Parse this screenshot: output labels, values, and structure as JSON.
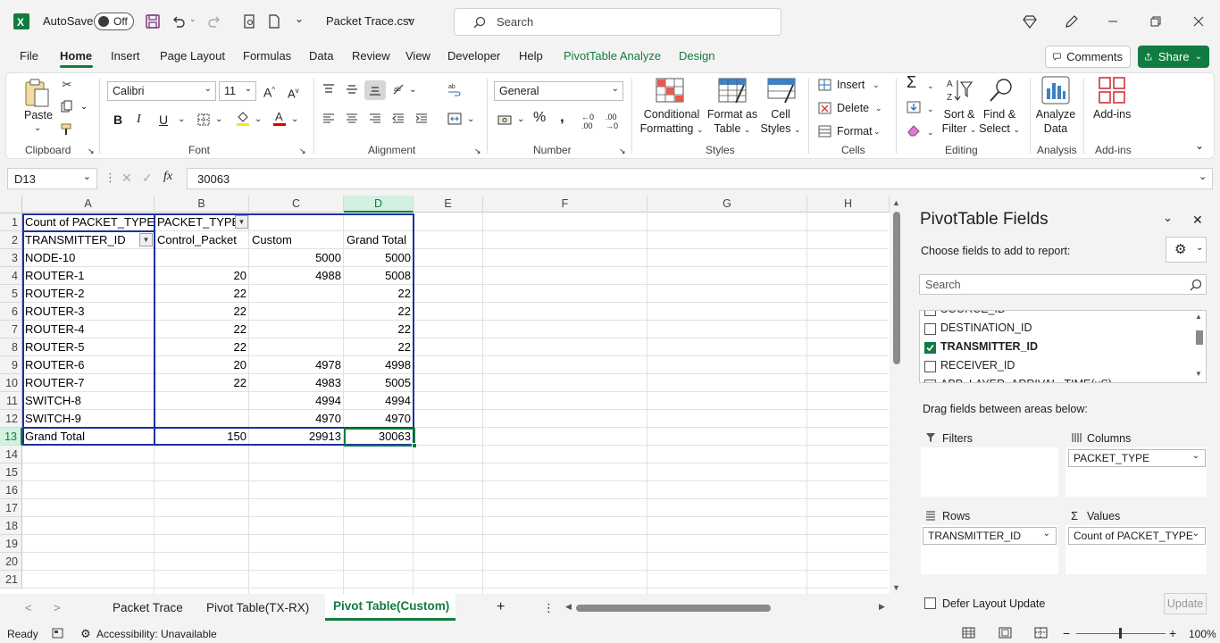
{
  "titlebar": {
    "autosave_label": "AutoSave",
    "autosave_state": "Off",
    "filename": "Packet Trace.csv",
    "search_placeholder": "Search"
  },
  "menu": {
    "tabs": [
      "File",
      "Home",
      "Insert",
      "Page Layout",
      "Formulas",
      "Data",
      "Review",
      "View",
      "Developer",
      "Help",
      "PivotTable Analyze",
      "Design"
    ],
    "active": "Home",
    "comments_label": "Comments",
    "share_label": "Share"
  },
  "ribbon": {
    "clipboard": {
      "paste": "Paste",
      "label": "Clipboard"
    },
    "font": {
      "name": "Calibri",
      "size": "11",
      "label": "Font"
    },
    "alignment": {
      "label": "Alignment"
    },
    "number": {
      "format": "General",
      "label": "Number"
    },
    "styles": {
      "conditional": [
        "Conditional",
        "Formatting"
      ],
      "format_table": [
        "Format as",
        "Table"
      ],
      "cell_styles": [
        "Cell",
        "Styles"
      ],
      "label": "Styles"
    },
    "cells": {
      "insert": "Insert",
      "delete": "Delete",
      "format": "Format",
      "label": "Cells"
    },
    "editing": {
      "sort": [
        "Sort &",
        "Filter"
      ],
      "find": [
        "Find &",
        "Select"
      ],
      "label": "Editing"
    },
    "analysis": {
      "analyze": [
        "Analyze",
        "Data"
      ],
      "label": "Analysis"
    },
    "addins": {
      "button": "Add-ins",
      "label": "Add-ins"
    }
  },
  "formula_bar": {
    "name_box": "D13",
    "fx": "fx",
    "value": "30063"
  },
  "columns": [
    "A",
    "B",
    "C",
    "D",
    "E",
    "F",
    "G",
    "H"
  ],
  "rows": [
    "1",
    "2",
    "3",
    "4",
    "5",
    "6",
    "7",
    "8",
    "9",
    "10",
    "11",
    "12",
    "13",
    "14",
    "15",
    "16",
    "17",
    "18",
    "19",
    "20",
    "21"
  ],
  "pivot": {
    "a1": "Count of PACKET_TYPE",
    "b1": "PACKET_TYPE",
    "a2": "TRANSMITTER_ID",
    "b2": "Control_Packet",
    "c2": "Custom",
    "d2": "Grand Total",
    "data": [
      [
        "NODE-10",
        "",
        "5000",
        "5000"
      ],
      [
        "ROUTER-1",
        "20",
        "4988",
        "5008"
      ],
      [
        "ROUTER-2",
        "22",
        "",
        "22"
      ],
      [
        "ROUTER-3",
        "22",
        "",
        "22"
      ],
      [
        "ROUTER-4",
        "22",
        "",
        "22"
      ],
      [
        "ROUTER-5",
        "22",
        "",
        "22"
      ],
      [
        "ROUTER-6",
        "20",
        "4978",
        "4998"
      ],
      [
        "ROUTER-7",
        "22",
        "4983",
        "5005"
      ],
      [
        "SWITCH-8",
        "",
        "4994",
        "4994"
      ],
      [
        "SWITCH-9",
        "",
        "4970",
        "4970"
      ],
      [
        "Grand Total",
        "150",
        "29913",
        "30063"
      ]
    ]
  },
  "pane": {
    "title": "PivotTable Fields",
    "choose": "Choose fields to add to report:",
    "search_placeholder": "Search",
    "fields": [
      {
        "name": "SOURCE_ID",
        "checked": false
      },
      {
        "name": "DESTINATION_ID",
        "checked": false
      },
      {
        "name": "TRANSMITTER_ID",
        "checked": true
      },
      {
        "name": "RECEIVER_ID",
        "checked": false
      },
      {
        "name": "APP_LAYER_ARRIVAL_TIME(uS)",
        "checked": false
      }
    ],
    "drag_text": "Drag fields between areas below:",
    "filters": "Filters",
    "columns": "Columns",
    "columns_value": "PACKET_TYPE",
    "rows": "Rows",
    "rows_value": "TRANSMITTER_ID",
    "values": "Values",
    "values_value": "Count of PACKET_TYPE",
    "defer": "Defer Layout Update",
    "update": "Update"
  },
  "sheets": {
    "tabs": [
      "Packet Trace",
      "Pivot Table(TX-RX)",
      "Pivot Table(Custom)"
    ],
    "active": "Pivot Table(Custom)"
  },
  "status": {
    "ready": "Ready",
    "accessibility": "Accessibility: Unavailable",
    "zoom": "100%"
  },
  "colors": {
    "accent": "#107c41",
    "pivot_border": "#1f2fa0"
  }
}
